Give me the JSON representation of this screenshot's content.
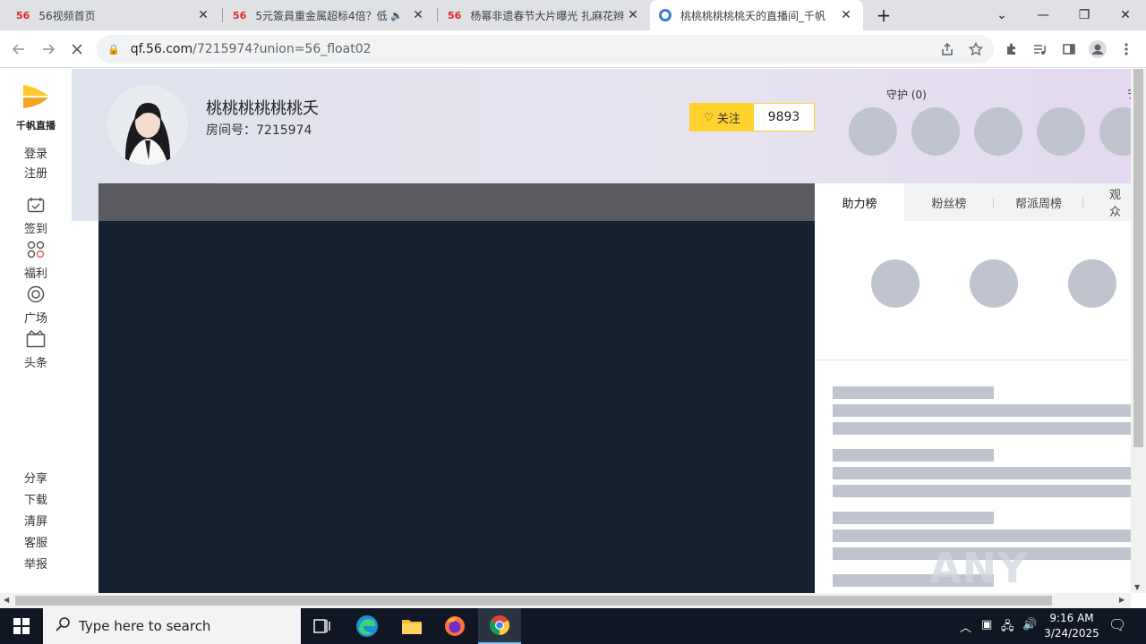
{
  "browser": {
    "tabs": [
      {
        "favicon": "56",
        "title": "56视频首页",
        "close": "✕"
      },
      {
        "favicon": "56",
        "title": "5元簽員重金属超标4倍？低",
        "close": "✕"
      },
      {
        "favicon": "56",
        "title": "杨幂非遗春节大片曝光 扎麻花辫",
        "close": "✕"
      },
      {
        "favicon": "",
        "title": "桃桃桃桃桃桃夭的直播间_千帆",
        "close": "✕"
      }
    ],
    "new_tab": "+",
    "window": {
      "dropdown": "⌄",
      "minimize": "—",
      "maximize": "❐",
      "close": "✕"
    },
    "url_host": "qf.56.com",
    "url_path": "/7215974?union=56_float02"
  },
  "leftnav": {
    "logo_text": "千帆直播",
    "login": "登录",
    "register": "注册",
    "items": [
      {
        "label": "签到",
        "icon": "calendar-check-icon"
      },
      {
        "label": "福利",
        "icon": "grid-gift-icon"
      },
      {
        "label": "广场",
        "icon": "target-circle-icon"
      },
      {
        "label": "头条",
        "icon": "tv-crown-icon"
      }
    ],
    "bottom": [
      "分享",
      "下载",
      "清屏",
      "客服",
      "举报"
    ]
  },
  "room": {
    "anchor_name": "桃桃桃桃桃桃夭",
    "room_id": "房间号：7215974",
    "follow_label": "关注",
    "follow_count": "9893",
    "guard_label": "守护 (0)",
    "right_edge_label": "ヲ"
  },
  "rank": {
    "tabs": [
      "助力榜",
      "粉丝榜",
      "帮派周榜",
      "观众"
    ]
  },
  "watermark": "ANY RUN",
  "taskbar": {
    "search_placeholder": "Type here to search",
    "time": "9:16 AM",
    "date": "3/24/2025"
  },
  "colors": {
    "follow_accent": "#ffd22e",
    "video_bg": "#152130",
    "skeleton": "#c0c4ce"
  }
}
